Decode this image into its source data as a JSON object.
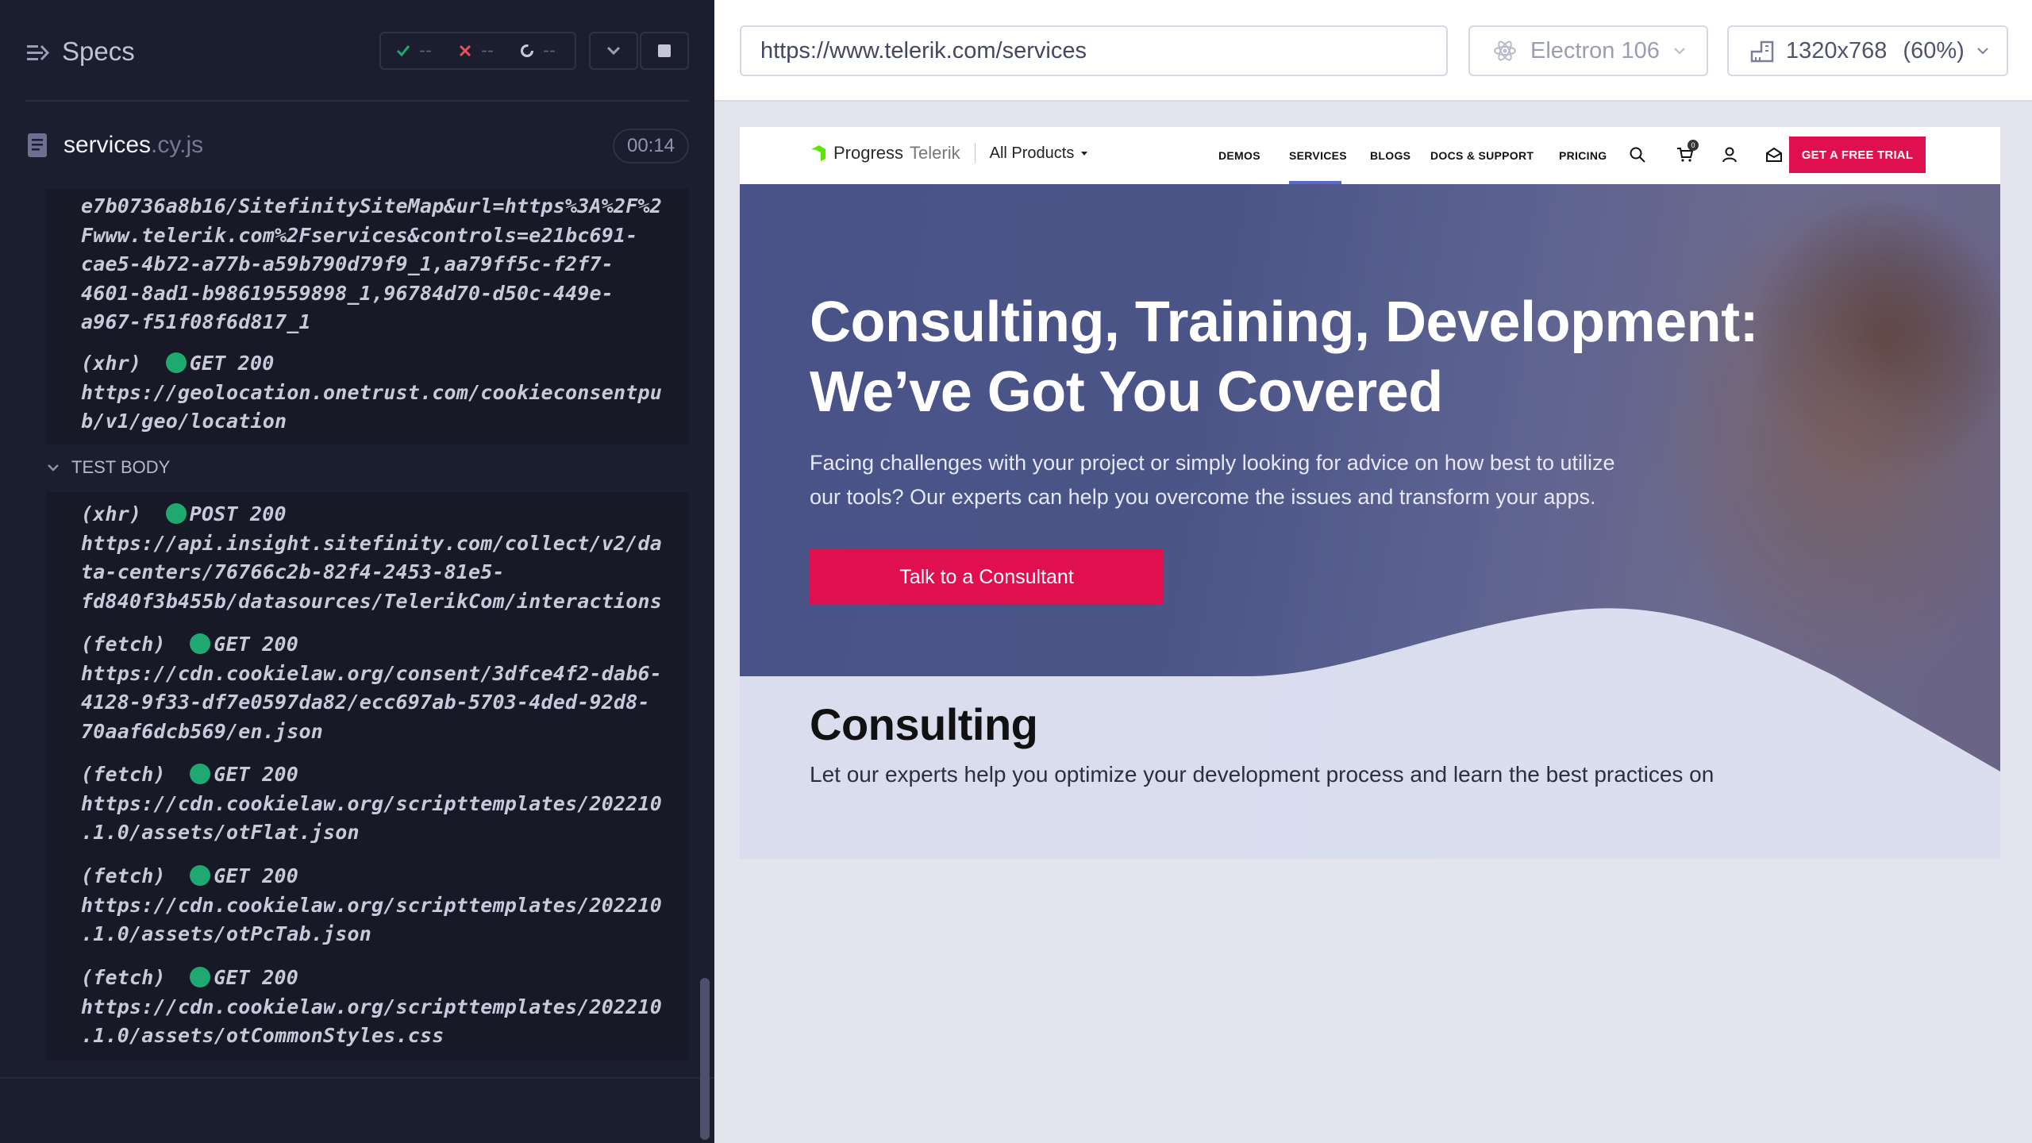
{
  "reporter": {
    "header_title": "Specs",
    "stats": {
      "passed": "--",
      "failed": "--",
      "pending": "--"
    },
    "spec": {
      "name": "services",
      "ext": ".cy.js",
      "timer": "00:14"
    },
    "section_label": "TEST BODY",
    "before_entries": [
      {
        "url": "e7b0736a8b16/SitefinitySiteMap&url=https%3A%2F%2\nFwww.telerik.com%2Fservices&controls=e21bc691-\ncae5-4b72-a77b-a59b790d79f9_1,aa79ff5c-f2f7-\n4601-8ad1-b98619559898_1,96784d70-d50c-449e-\na967-f51f08f6d817_1"
      },
      {
        "type": "(xhr)",
        "method": "GET 200",
        "url": "https://geolocation.onetrust.com/cookieconsentpu\nb/v1/geo/location"
      }
    ],
    "body_entries": [
      {
        "type": "(xhr)",
        "method": "POST 200",
        "url": "https://api.insight.sitefinity.com/collect/v2/da\nta-centers/76766c2b-82f4-2453-81e5-\nfd840f3b455b/datasources/TelerikCom/interactions"
      },
      {
        "type": "(fetch)",
        "method": "GET 200",
        "url": "https://cdn.cookielaw.org/consent/3dfce4f2-dab6-\n4128-9f33-df7e0597da82/ecc697ab-5703-4ded-92d8-\n70aaf6dcb569/en.json"
      },
      {
        "type": "(fetch)",
        "method": "GET 200",
        "url": "https://cdn.cookielaw.org/scripttemplates/202210\n.1.0/assets/otFlat.json"
      },
      {
        "type": "(fetch)",
        "method": "GET 200",
        "url": "https://cdn.cookielaw.org/scripttemplates/202210\n.1.0/assets/otPcTab.json"
      },
      {
        "type": "(fetch)",
        "method": "GET 200",
        "url": "https://cdn.cookielaw.org/scripttemplates/202210\n.1.0/assets/otCommonStyles.css"
      }
    ]
  },
  "aut": {
    "url": "https://www.telerik.com/services",
    "browser": "Electron 106",
    "viewport": "1320x768",
    "zoom": "(60%)"
  },
  "site": {
    "logo_brand": "Progress",
    "logo_product": "Telerik",
    "all_products": "All Products",
    "nav": [
      "DEMOS",
      "SERVICES",
      "BLOGS",
      "DOCS & SUPPORT",
      "PRICING"
    ],
    "active_nav": "SERVICES",
    "cart_count": "0",
    "trial_button": "GET A FREE TRIAL",
    "hero_title_line1": "Consulting, Training, Development:",
    "hero_title_line2": "We’ve Got You Covered",
    "hero_sub": "Facing challenges with your project or simply looking for advice on how best to utilize our tools? Our experts can help you overcome the issues and transform your apps.",
    "hero_cta": "Talk to a Consultant",
    "section_title": "Consulting",
    "section_text": "Let our experts help you optimize your development process and learn the best practices on"
  },
  "colors": {
    "reporter_bg": "#1b1e2e",
    "success_green": "#1fa971",
    "fail_red": "#e94f5f",
    "accent_pink": "#e0104f",
    "nav_underline": "#5b67d8"
  }
}
